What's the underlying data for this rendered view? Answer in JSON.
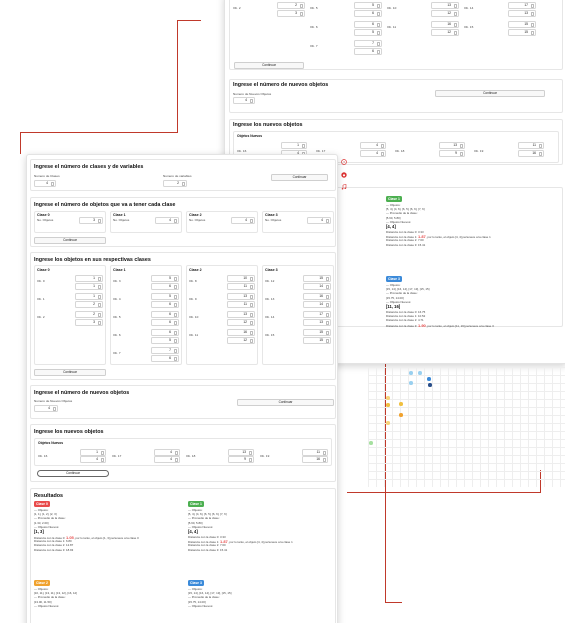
{
  "colors": {
    "accent": "#c0392b",
    "class0": "#e84a4a",
    "class1": "#4caf50",
    "class2": "#f0a22e",
    "class3": "#3b8ad9"
  },
  "icons": [
    "help-circle-icon",
    "github-icon",
    "music-note-icon"
  ],
  "main": {
    "s1": {
      "title": "Ingrese el número de clases y de variables",
      "classes_label": "Numero de Clases",
      "classes_value": "4",
      "vars_label": "Numero de variables",
      "vars_value": "2",
      "continue": "Continuar"
    },
    "s2": {
      "title": "Ingrese el número de objetos que va a tener cada clase",
      "obj_label": "No. Objetos",
      "continue": "Continuar",
      "classes": [
        {
          "name": "Clase 0",
          "value": "3"
        },
        {
          "name": "Clase 1",
          "value": "4"
        },
        {
          "name": "Clase 2",
          "value": "4"
        },
        {
          "name": "Clase 3",
          "value": "4"
        }
      ]
    },
    "s3": {
      "title": "Ingrese los objetos en sus respectivas clases",
      "continue": "Continuar",
      "classes": [
        {
          "name": "Clase 0",
          "objs": [
            {
              "label": "Ob. 0",
              "a": "1",
              "b": "1"
            },
            {
              "label": "Ob. 1",
              "a": "1",
              "b": "2"
            },
            {
              "label": "Ob. 2",
              "a": "2",
              "b": "3"
            }
          ]
        },
        {
          "name": "Clase 1",
          "objs": [
            {
              "label": "Ob. 3",
              "a": "5",
              "b": "6"
            },
            {
              "label": "Ob. 4",
              "a": "5",
              "b": "6"
            },
            {
              "label": "Ob. 5",
              "a": "6",
              "b": "6"
            },
            {
              "label": "Ob. 6",
              "a": "6",
              "b": "5"
            },
            {
              "label": "Ob. 7",
              "a": "7",
              "b": "6"
            }
          ]
        },
        {
          "name": "Clase 2",
          "objs": [
            {
              "label": "Ob. 8",
              "a": "10",
              "b": "11"
            },
            {
              "label": "Ob. 9",
              "a": "13",
              "b": "11"
            },
            {
              "label": "Ob. 10",
              "a": "13",
              "b": "12"
            },
            {
              "label": "Ob. 11",
              "a": "16",
              "b": "12"
            }
          ]
        },
        {
          "name": "Clase 3",
          "objs": [
            {
              "label": "Ob. 12",
              "a": "15",
              "b": "14"
            },
            {
              "label": "Ob. 13",
              "a": "16",
              "b": "14"
            },
            {
              "label": "Ob. 14",
              "a": "17",
              "b": "13"
            },
            {
              "label": "Ob. 15",
              "a": "15",
              "b": "15"
            }
          ]
        }
      ]
    },
    "s4": {
      "title": "Ingrese el número de nuevos objetos",
      "label": "Numero de Nuevos Objetos",
      "value": "4",
      "continue": "Continuar"
    },
    "s5": {
      "title": "Ingrese los nuevos objetos",
      "sub": "Objetos Nuevos",
      "continue": "Continuar",
      "objs": [
        {
          "label": "Ob. 16",
          "a": "1",
          "b": "4"
        },
        {
          "label": "Ob. 17",
          "a": "4",
          "b": "4"
        },
        {
          "label": "Ob. 18",
          "a": "13",
          "b": "9"
        },
        {
          "label": "Ob. 19",
          "a": "11",
          "b": "16"
        }
      ]
    },
    "results": {
      "title": "Resultados",
      "cards": [
        {
          "name": "Clase 0",
          "objetos_h": "— Objetos:",
          "objetos": "[1, 1], [1, 2], [2, 3]",
          "prom_h": "— Promedio de la clase:",
          "prom": "[1.33, 2.00]",
          "nuevos_h": "— Objetos Nuevos:",
          "nuevos": "[1, 3]",
          "d0a": "Distancia con la clase 0: ",
          "d0v": "1.05",
          "d0b": ", por lo tanto, el objeto [1, 3] pertenece a la clase 0",
          "d1": "Distancia con la clase 1: 6.80",
          "d2": "Distancia con la clase 2: 12.87",
          "d3": "Distancia con la clase 3: 18.93"
        },
        {
          "name": "Clase 1",
          "objetos_h": "— Objetos:",
          "objetos": "[5, 4], [4, 6], [6, 5], [6, 6], [7, 6]",
          "prom_h": "— Promedio de la clase:",
          "prom": "[5.60, 5.80]",
          "nuevos_h": "— Objetos Nuevos:",
          "nuevos": "[4, 4]",
          "d0": "Distancia con la clase 0: 3.33",
          "d1a": "Distancia con la clase 1: ",
          "d1v": "1.87",
          "d1b": ", por lo tanto, el objeto [4, 4] pertenece a la clase 1",
          "d2": "Distancia con la clase 2: 7.60",
          "d3": "Distancia con la clase 3: 15.41"
        },
        {
          "name": "Clase 2",
          "objetos_h": "— Objetos:",
          "objetos": "[10, 11], [13, 11], [13, 12], [16, 12]",
          "prom_h": "— Promedio de la clase:",
          "prom": "[13.00, 11.50]",
          "nuevos_h": "— Objetos Nuevos:",
          "nuevos": ""
        },
        {
          "name": "Clase 3",
          "objetos_h": "— Objetos:",
          "objetos": "[15, 14], [16, 14], [17, 13], [15, 15]",
          "prom_h": "— Promedio de la clase:",
          "prom": "[15.75, 14.00]",
          "nuevos_h": "— Objetos Nuevos:",
          "nuevos": "[11, 16]",
          "d0": "Distancia con la clase 0: 16.75",
          "d1": "Distancia con la clase 1: 10.52",
          "d2": "Distancia con la clase 2: 4.71",
          "d3a": "Distancia con la clase 3: ",
          "d3v": "1.90",
          "d3b": ", por lo tanto, el objeto [11, 16] pertenece a la clase 3"
        }
      ]
    }
  },
  "back": {
    "rows": [
      {
        "label": "Ob. 2",
        "a": "2",
        "b": "3"
      },
      {
        "label": "Ob. 5",
        "a": "5",
        "b": "6"
      },
      {
        "label": "Ob. 6",
        "a": "6",
        "b": "5"
      },
      {
        "label": "Ob. 7",
        "a": "7",
        "b": "6"
      },
      {
        "label": "Ob. 10",
        "a": "13",
        "b": "12"
      },
      {
        "label": "Ob. 11",
        "a": "16",
        "b": "12"
      },
      {
        "label": "Ob. 14",
        "a": "17",
        "b": "13"
      },
      {
        "label": "Ob. 15",
        "a": "15",
        "b": "15"
      }
    ],
    "continue": "Continuar",
    "s4_title": "Ingrese el número de nuevos objetos",
    "s4_label": "Numero de Nuevos Objetos",
    "s4_value": "4",
    "s4_continue": "Continuar",
    "s5_title": "Ingrese los nuevos objetos",
    "s5_sub": "Objetos Nuevos",
    "s5_objs": [
      {
        "label": "Ob. 16",
        "a": "1",
        "b": "4"
      },
      {
        "label": "Ob. 17",
        "a": "4",
        "b": "4"
      },
      {
        "label": "Ob. 18",
        "a": "13",
        "b": "9"
      },
      {
        "label": "Ob. 19",
        "a": "11",
        "b": "16"
      }
    ],
    "res_card1": {
      "name": "Clase 1",
      "objetos_h": "— Objetos:",
      "objetos": "[5, 4], [4, 6], [6, 5], [6, 6], [7, 6]",
      "prom_h": "— Promedio de la clase:",
      "prom": "[5.60, 5.80]",
      "nuevos_h": "— Objetos Nuevos:",
      "nuevos": "[4, 4]",
      "d0": "Distancia con la clase 0: 3.33",
      "d1a": "Distancia con la clase 1: ",
      "d1v": "1.87",
      "d1b": ", por lo tanto, el objeto [4, 4] pertenece a la clase 1",
      "d2": "Distancia con la clase 2: 7.60",
      "d3": "Distancia con la clase 3: 15.41"
    },
    "res_card3": {
      "name": "Clase 3",
      "objetos_h": "— Objetos:",
      "objetos": "[15, 14], [16, 14], [17, 13], [15, 15]",
      "prom_h": "— Promedio de la clase:",
      "prom": "[15.75, 14.00]",
      "nuevos_h": "— Objetos Nuevos:",
      "nuevos": "[11, 16]",
      "d0": "Distancia con la clase 0: 16.75",
      "d1": "Distancia con la clase 1: 10.52",
      "d2": "Distancia con la clase 2: 4.71",
      "d3a": "Distancia con la clase 3: ",
      "d3v": "1.90",
      "d3b": ", por lo tanto, el objeto [11, 16] pertenece a la clase 3"
    }
  }
}
